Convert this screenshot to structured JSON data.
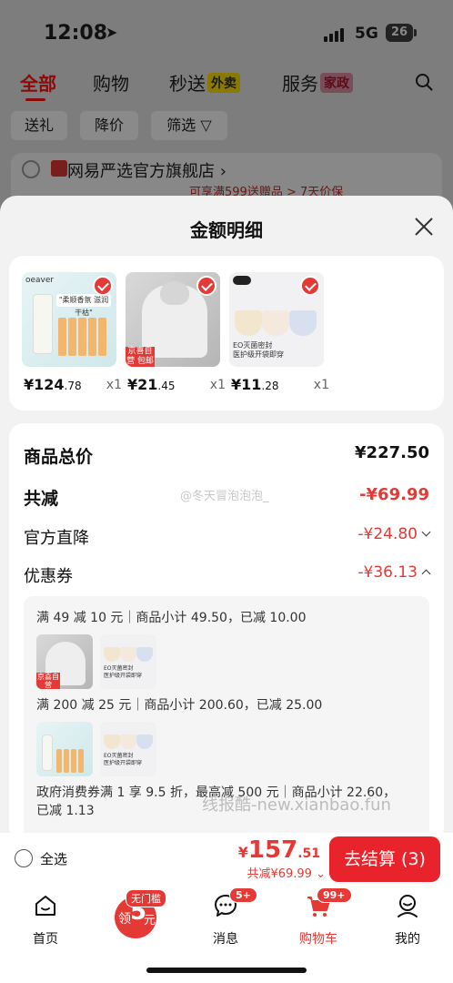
{
  "status_bar": {
    "time": "12:08",
    "network": "5G",
    "battery": "26"
  },
  "top_tabs": [
    {
      "label": "全部"
    },
    {
      "label": "购物"
    },
    {
      "label": "秒送",
      "badge": "外卖"
    },
    {
      "label": "服务",
      "badge": "家政"
    }
  ],
  "filters": [
    {
      "label": "送礼"
    },
    {
      "label": "降价"
    },
    {
      "label": "筛选"
    }
  ],
  "store": {
    "name": "网易严选官方旗舰店",
    "promo": "可享满599送赠品 > 7天价保"
  },
  "sheet": {
    "title": "金额明细",
    "products": [
      {
        "price_int": "¥124",
        "price_dec": ".78",
        "qty": "x1",
        "img_brand": "oeaver",
        "img_band": "\"柔顺香氛 滋润干枯\""
      },
      {
        "price_int": "¥21",
        "price_dec": ".45",
        "qty": "x1",
        "img_tag": "京喜自营\n包邮"
      },
      {
        "price_int": "¥11",
        "price_dec": ".28",
        "qty": "x1",
        "img_cap": "EO灭菌密封\n医护级开袋即穿"
      }
    ],
    "summary": {
      "total_label": "商品总价",
      "total_value": "¥227.50",
      "reduce_label": "共减",
      "reduce_value": "-¥69.99",
      "direct_label": "官方直降",
      "direct_value": "-¥24.80",
      "coupon_label": "优惠券",
      "coupon_value": "-¥36.13"
    },
    "coupons": [
      {
        "text": "满 49 减 10 元｜商品小计 49.50，已减 10.00"
      },
      {
        "text": "满 200 减 25 元｜商品小计 200.60，已减 25.00"
      },
      {
        "text": "政府消费券满 1 享 9.5 折，最高减 500 元｜商品小计 22.60，",
        "text2": "已减 1.13"
      }
    ],
    "mini_caption": "EO灭菌密封\n医护级开袋即穿",
    "mini_tag": "京喜自营\n包邮"
  },
  "watermark": {
    "user": "@冬天冒泡泡泡_",
    "site": "线报酷-new.xianbao.fun"
  },
  "checkout": {
    "select_all": "全选",
    "currency": "¥",
    "total_int": "157",
    "total_dec": ".51",
    "saved": "共减¥69.99",
    "button": "去结算 (3)"
  },
  "nav": {
    "home": "首页",
    "coupon_ribbon": "无门槛",
    "coupon_prefix": "领",
    "coupon_amount": "5",
    "coupon_unit": "元",
    "messages": "消息",
    "messages_badge": "5+",
    "cart": "购物车",
    "cart_badge": "99+",
    "me": "我的"
  },
  "colors": {
    "accent": "#e53935",
    "checkout_button": "#e8232b",
    "sheet_bg": "#f2f2f2"
  }
}
